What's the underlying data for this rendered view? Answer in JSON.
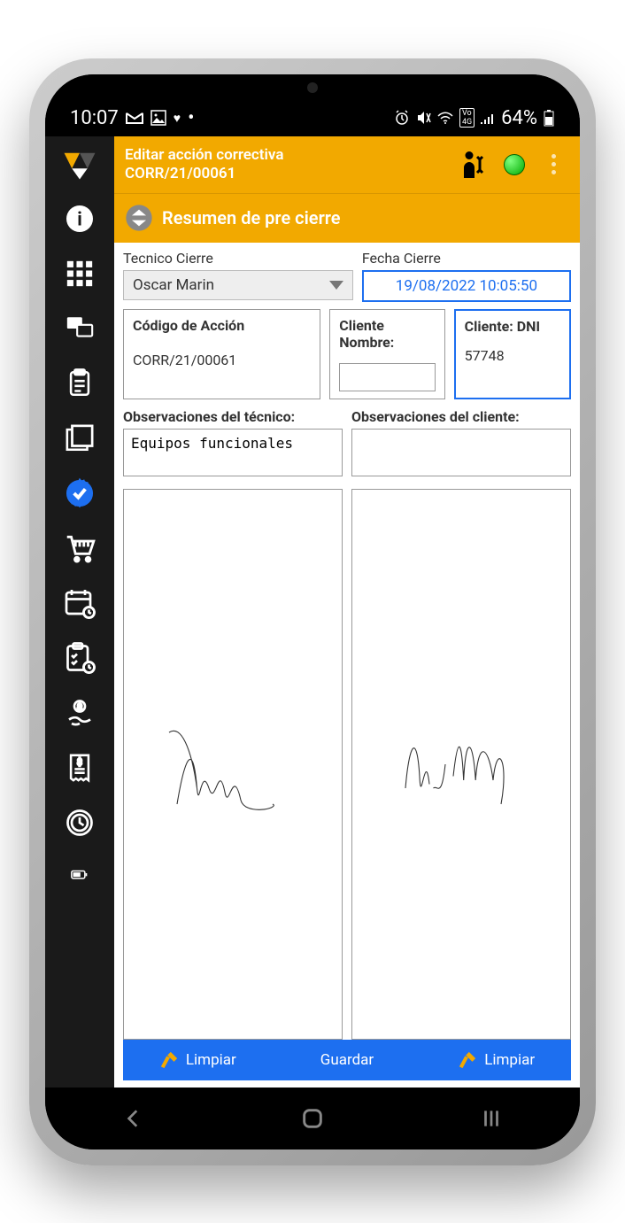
{
  "status_bar": {
    "time": "10:07",
    "battery": "64%"
  },
  "header": {
    "title_line1": "Editar acción correctiva",
    "title_line2": "CORR/21/00061"
  },
  "subheader": {
    "title": "Resumen de pre cierre"
  },
  "form": {
    "tecnico_label": "Tecnico Cierre",
    "tecnico_value": "Oscar Marin",
    "fecha_label": "Fecha Cierre",
    "fecha_value": "19/08/2022 10:05:50",
    "codigo_label": "Código de Acción",
    "codigo_value": "CORR/21/00061",
    "cliente_nombre_label": "Cliente Nombre:",
    "cliente_nombre_value": "",
    "cliente_dni_label": "Cliente: DNI",
    "cliente_dni_value": "57748",
    "obs_tecnico_label": "Observaciones del técnico:",
    "obs_tecnico_value": "Equipos funcionales",
    "obs_cliente_label": "Observaciones del cliente:",
    "obs_cliente_value": ""
  },
  "actions": {
    "limpiar_left": "Limpiar",
    "guardar": "Guardar",
    "limpiar_right": "Limpiar"
  }
}
